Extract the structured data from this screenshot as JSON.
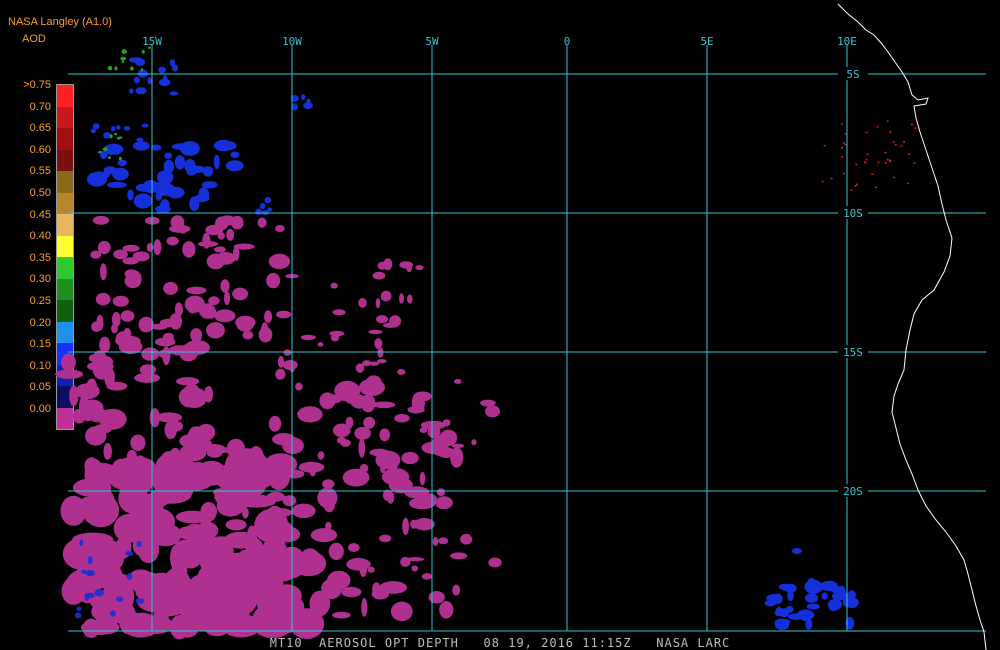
{
  "header": {
    "source": "NASA Langley (A1.0)",
    "product": "AOD"
  },
  "legend": {
    "labels": [
      ">0.75",
      "0.70",
      "0.65",
      "0.60",
      "0.55",
      "0.50",
      "0.45",
      "0.40",
      "0.35",
      "0.30",
      "0.25",
      "0.20",
      "0.15",
      "0.10",
      "0.05",
      "0.00"
    ],
    "colors": [
      "#ff2020",
      "#c81818",
      "#a01010",
      "#7a1010",
      "#8a6a1a",
      "#b8862a",
      "#e8b860",
      "#ffff30",
      "#30c830",
      "#1e901e",
      "#106010",
      "#2090f0",
      "#1830ff",
      "#1020b0",
      "#0a0e60",
      "#c0309a"
    ]
  },
  "grid": {
    "longitude_labels": [
      "15W",
      "10W",
      "5W",
      "0",
      "5E",
      "10E"
    ],
    "latitude_labels": [
      "5S",
      "10S",
      "15S",
      "20S"
    ]
  },
  "colors": {
    "grid": "#35c4d4",
    "coast": "#ffffff",
    "label": "#35c4d4",
    "low_aod": "#b0308f",
    "mid_aod": "#1530d8",
    "high_aod": "#d81e1e",
    "green_aod": "#28a028"
  },
  "caption": "MT10  AEROSOL OPT DEPTH   08 19, 2016 11:15Z   NASA LARC"
}
